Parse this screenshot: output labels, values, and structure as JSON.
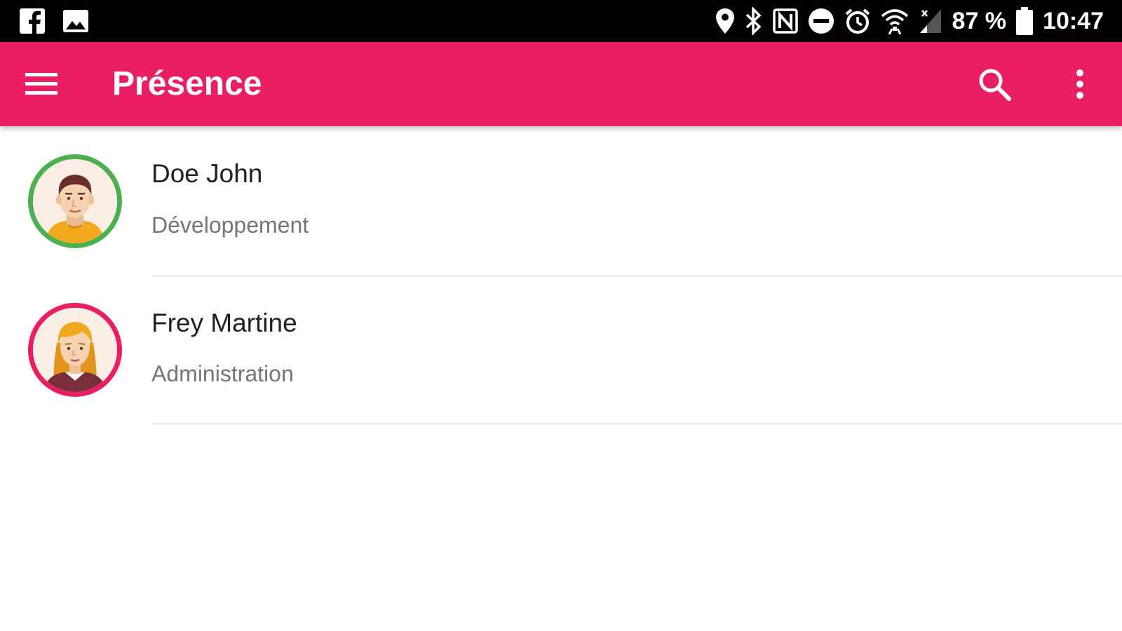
{
  "status_bar": {
    "left_icons": [
      "facebook-icon",
      "image-icon"
    ],
    "right_icons": [
      "location-icon",
      "bluetooth-icon",
      "nfc-icon",
      "do-not-disturb-icon",
      "alarm-icon",
      "wifi-icon",
      "cellular-signal-icon",
      "battery-icon"
    ],
    "battery_text": "87 %",
    "time": "10:47"
  },
  "app_bar": {
    "title": "Présence",
    "color": "#E91E63",
    "menu_icon": "hamburger-menu-icon",
    "search_icon": "search-icon",
    "more_icon": "more-vert-icon"
  },
  "contacts": [
    {
      "name": "Doe John",
      "department": "Développement",
      "status_color": "#4CAF50",
      "avatar": "male-avatar"
    },
    {
      "name": "Frey Martine",
      "department": "Administration",
      "status_color": "#E91E63",
      "avatar": "female-avatar"
    }
  ]
}
